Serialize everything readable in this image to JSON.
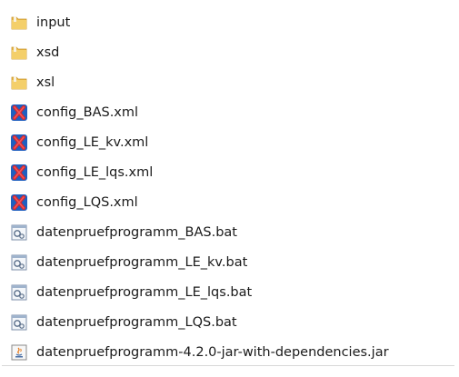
{
  "files": [
    {
      "name": "input",
      "icon": "folder-icon"
    },
    {
      "name": "xsd",
      "icon": "folder-icon"
    },
    {
      "name": "xsl",
      "icon": "folder-icon"
    },
    {
      "name": "config_BAS.xml",
      "icon": "xml-file-icon"
    },
    {
      "name": "config_LE_kv.xml",
      "icon": "xml-file-icon"
    },
    {
      "name": "config_LE_lqs.xml",
      "icon": "xml-file-icon"
    },
    {
      "name": "config_LQS.xml",
      "icon": "xml-file-icon"
    },
    {
      "name": "datenpruefprogramm_BAS.bat",
      "icon": "batch-file-icon"
    },
    {
      "name": "datenpruefprogramm_LE_kv.bat",
      "icon": "batch-file-icon"
    },
    {
      "name": "datenpruefprogramm_LE_lqs.bat",
      "icon": "batch-file-icon"
    },
    {
      "name": "datenpruefprogramm_LQS.bat",
      "icon": "batch-file-icon"
    },
    {
      "name": "datenpruefprogramm-4.2.0-jar-with-dependencies.jar",
      "icon": "jar-file-icon"
    }
  ],
  "colors": {
    "folder": "#e9b84a",
    "xml_red": "#d9262b",
    "xml_blue": "#1f5fbf",
    "bat_frame": "#7b8ea8",
    "jar_orange": "#e67e22"
  }
}
